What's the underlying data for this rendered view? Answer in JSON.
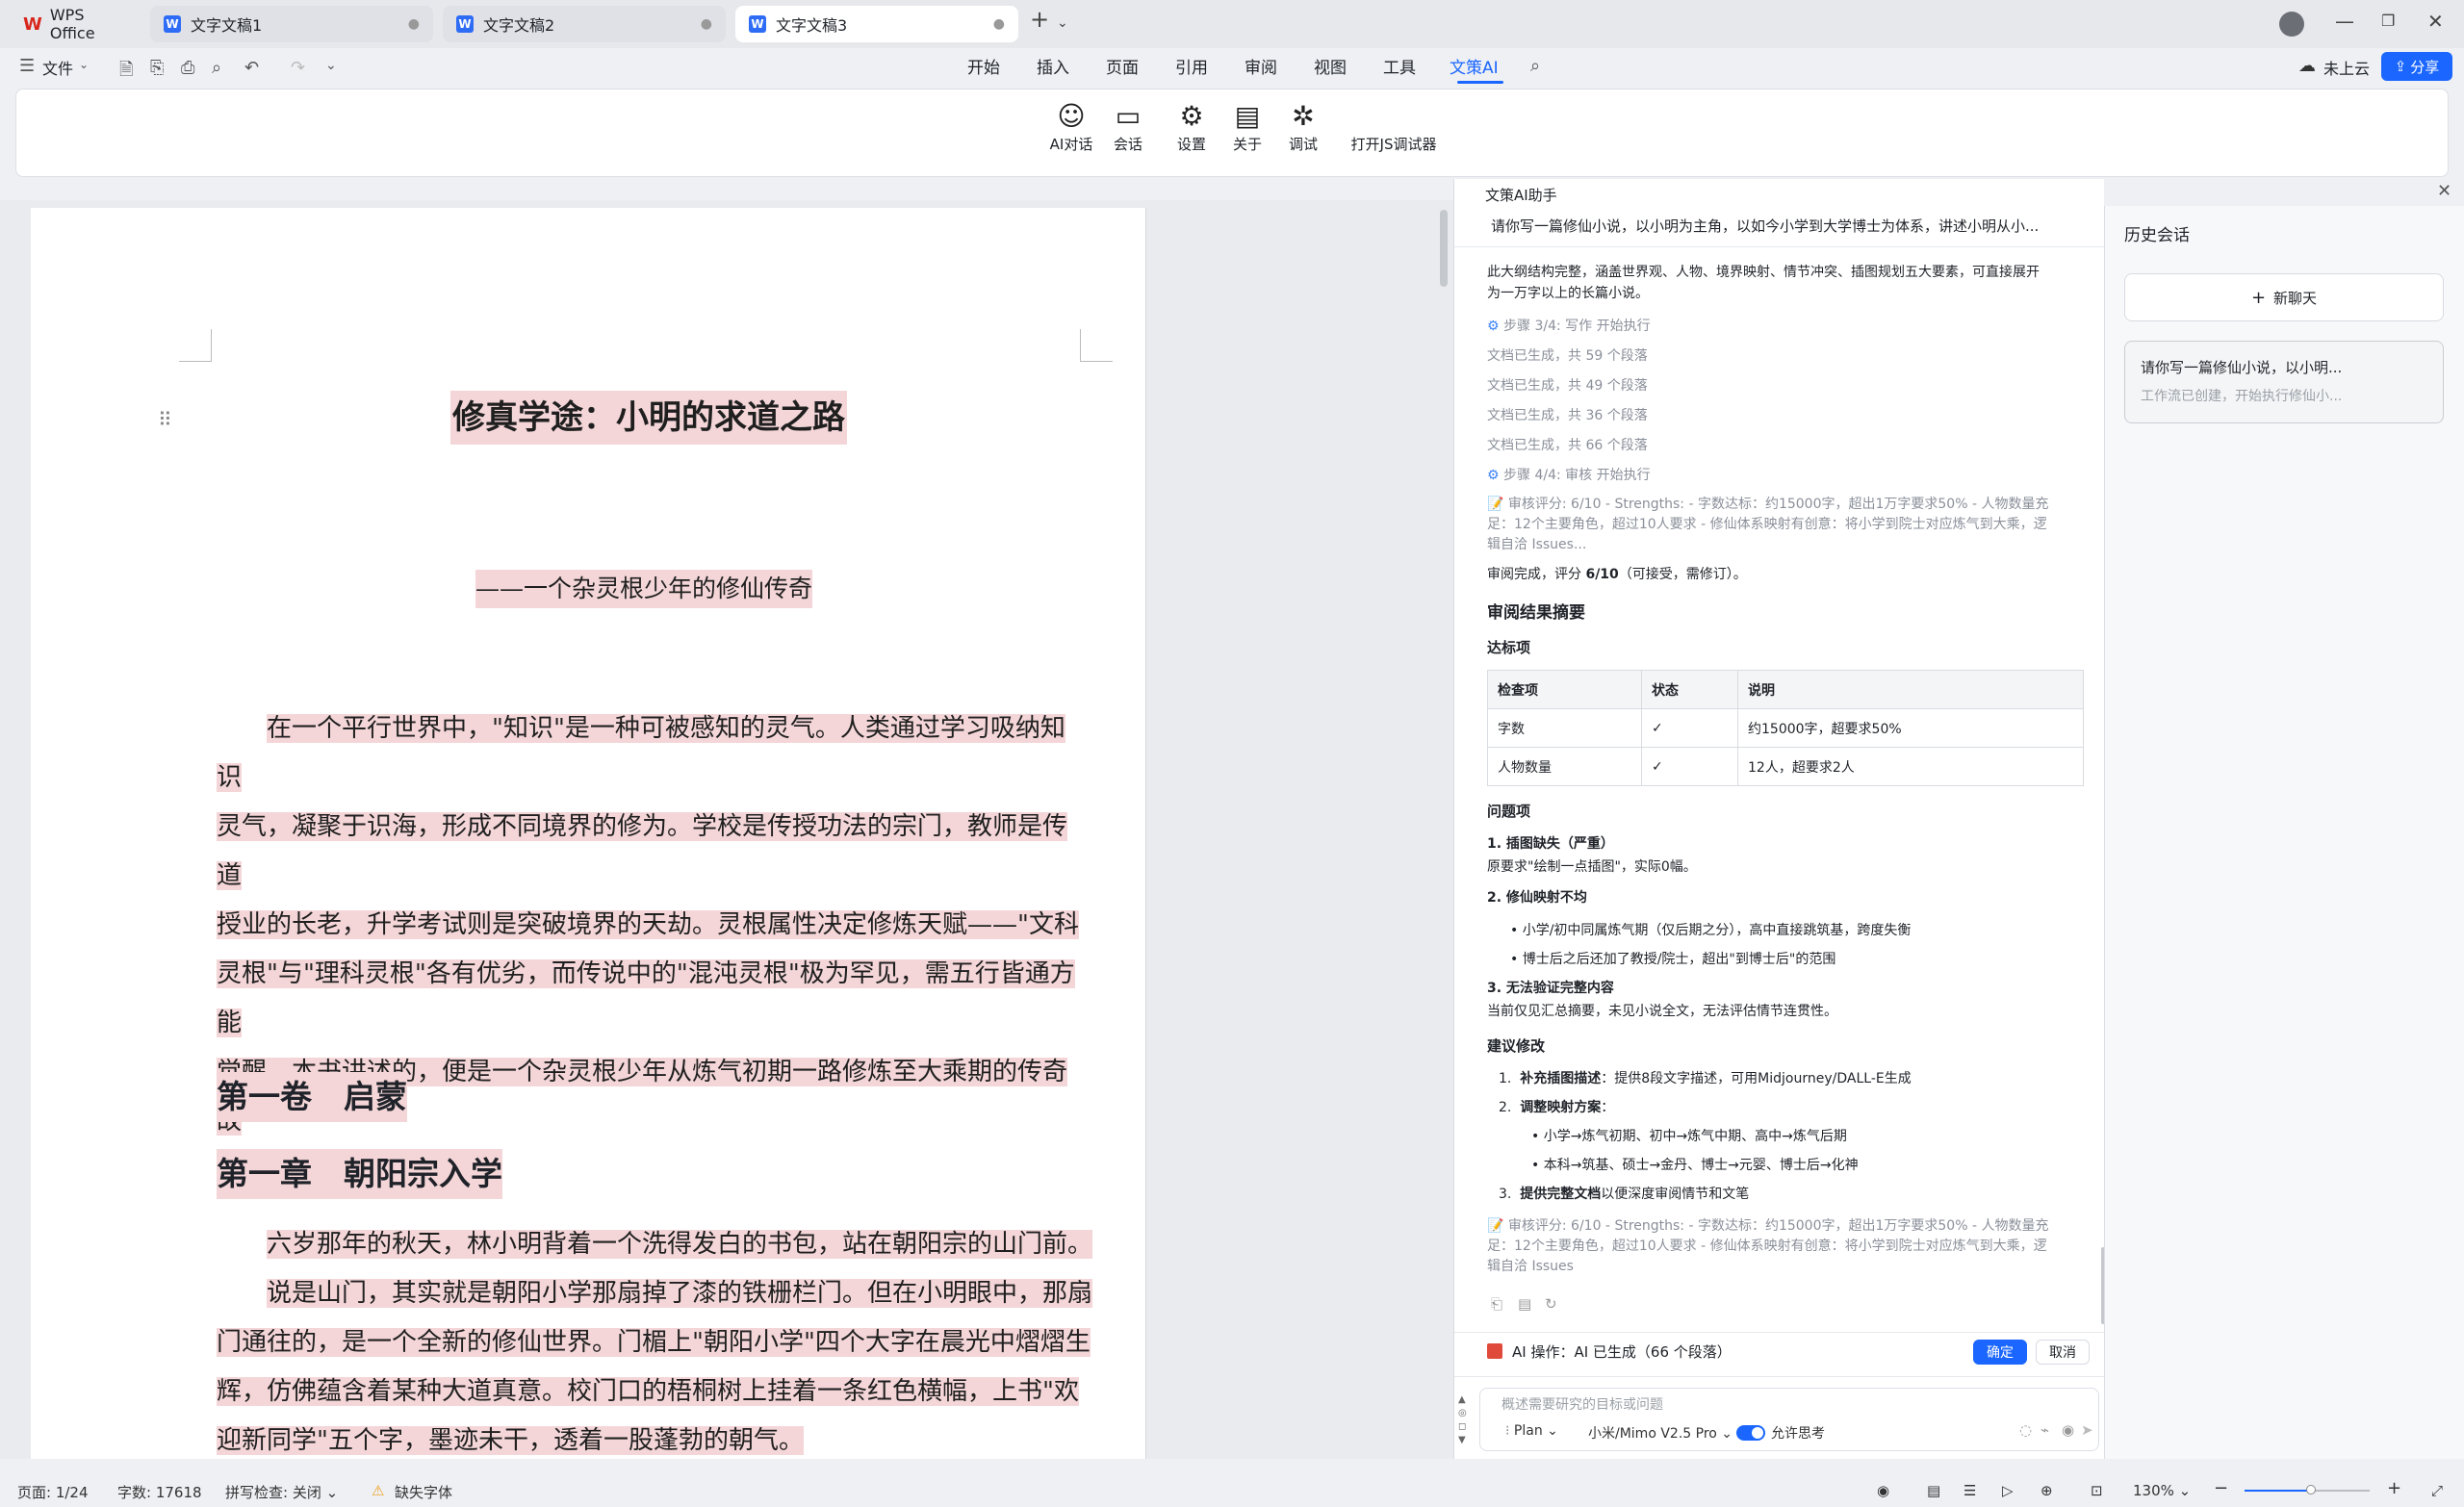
{
  "tabs": {
    "wps": "WPS Office",
    "doc1": "文字文稿1",
    "doc2": "文字文稿2",
    "doc3": "文字文稿3"
  },
  "menu": {
    "file": "文件",
    "tabs": [
      "开始",
      "插入",
      "页面",
      "引用",
      "审阅",
      "视图",
      "工具",
      "文策AI"
    ],
    "cloud": "未上云",
    "share": "分享"
  },
  "ribbon": {
    "items": [
      "AI对话",
      "会话",
      "设置",
      "关于",
      "调试",
      "打开JS调试器"
    ]
  },
  "document": {
    "title": "修真学途：小明的求道之路",
    "subtitle": "——一个杂灵根少年的修仙传奇",
    "intro_lines": [
      "在一个平行世界中，\"知识\"是一种可被感知的灵气。人类通过学习吸纳知识",
      "灵气，凝聚于识海，形成不同境界的修为。学校是传授功法的宗门，教师是传道",
      "授业的长老，升学考试则是突破境界的天劫。灵根属性决定修炼天赋——\"文科",
      "灵根\"与\"理科灵根\"各有优劣，而传说中的\"混沌灵根\"极为罕见，需五行皆通方能",
      "觉醒。本书讲述的，便是一个杂灵根少年从炼气初期一路修炼至大乘期的传奇故",
      "事。"
    ],
    "volume": "第一卷　启蒙",
    "chapter": "第一章　朝阳宗入学",
    "para1": "六岁那年的秋天，林小明背着一个洗得发白的书包，站在朝阳宗的山门前。",
    "para2_lines": [
      "说是山门，其实就是朝阳小学那扇掉了漆的铁栅栏门。但在小明眼中，那扇",
      "门通往的，是一个全新的修仙世界。门楣上\"朝阳小学\"四个大字在晨光中熠熠生",
      "辉，仿佛蕴含着某种大道真意。校门口的梧桐树上挂着一条红色横幅，上书\"欢",
      "迎新同学\"五个字，墨迹未干，透着一股蓬勃的朝气。"
    ]
  },
  "ai": {
    "header": "文策AI助手",
    "prompt": "请你写一篇修仙小说，以小明为主角，以如今小学到大学博士为体系，讲述小明从小...",
    "summary1": "此大纲结构完整，涵盖世界观、人物、境界映射、情节冲突、插图规划五大要素，可直接展开",
    "summary2": "为一万字以上的长篇小说。",
    "step3": "步骤 3/4: 写作 开始执行",
    "gen": [
      "文档已生成，共 59 个段落",
      "文档已生成，共 49 个段落",
      "文档已生成，共 36 个段落",
      "文档已生成，共 66 个段落"
    ],
    "step4": "步骤 4/4: 审核 开始执行",
    "review_lines": [
      "📝 审核评分: 6/10 - Strengths: - 字数达标：约15000字，超出1万字要求50% - 人物数量充",
      "足：12个主要角色，超过10人要求 - 修仙体系映射有创意：将小学到院士对应炼气到大乘，逻",
      "辑自洽 Issues..."
    ],
    "review_done_prefix": "审阅完成，评分 ",
    "review_score": "6/10",
    "review_done_suffix": "（可接受，需修订）。",
    "summary_title": "审阅结果摘要",
    "pass_title": "达标项",
    "table_headers": [
      "检查项",
      "状态",
      "说明"
    ],
    "table_rows": [
      [
        "字数",
        "✓",
        "约15000字，超要求50%"
      ],
      [
        "人物数量",
        "✓",
        "12人，超要求2人"
      ]
    ],
    "issues_title": "问题项",
    "issue1_title": "1. 插图缺失（严重）",
    "issue1_text": "原要求\"绘制一点插图\"，实际0幅。",
    "issue2_title": "2. 修仙映射不均",
    "issue2_items": [
      "小学/初中同属炼气期（仅后期之分），高中直接跳筑基，跨度失衡",
      "博士后之后还加了教授/院士，超出\"到博士后\"的范围"
    ],
    "issue3_title": "3. 无法验证完整内容",
    "issue3_text": "当前仅见汇总摘要，未见小说全文，无法评估情节连贯性。",
    "suggest_title": "建议修改",
    "s1_num": "1.",
    "s1_bold": "补充插图描述",
    "s1_rest": "：提供8段文字描述，可用Midjourney/DALL-E生成",
    "s2_num": "2.",
    "s2_bold": "调整映射方案",
    "s2_rest": "：",
    "s2_items": [
      "小学→炼气初期、初中→炼气中期、高中→炼气后期",
      "本科→筑基、硕士→金丹、博士→元婴、博士后→化神"
    ],
    "s3_num": "3.",
    "s3_bold": "提供完整文档",
    "s3_rest": "以便深度审阅情节和文笔",
    "review2_lines": [
      "📝 审核评分: 6/10 - Strengths: - 字数达标：约15000字，超出1万字要求50% - 人物数量充",
      "足：12个主要角色，超过10人要求 - 修仙体系映射有创意：将小学到院士对应炼气到大乘，逻",
      "辑自洽 Issues"
    ],
    "op_text": "AI 操作：AI 已生成（66 个段落）",
    "confirm": "确定",
    "cancel": "取消",
    "input_placeholder": "概述需要研究的目标或问题",
    "plan": "Plan",
    "model": "小米/Mimo V2.5 Pro",
    "think": "允许思考"
  },
  "history": {
    "title": "历史会话",
    "new_chat": "新聊天",
    "item_title": "请你写一篇修仙小说，以小明...",
    "item_sub": "工作流已创建，开始执行修仙小..."
  },
  "status": {
    "page": "页面: 1/24",
    "words": "字数: 17618",
    "spell": "拼写检查: 关闭",
    "font": "缺失字体",
    "zoom": "130%"
  },
  "colors": {
    "accent": "#1a66ff",
    "highlight": "#f4d6d8",
    "wps_red": "#d9261c",
    "op_red": "#e04a3b"
  }
}
